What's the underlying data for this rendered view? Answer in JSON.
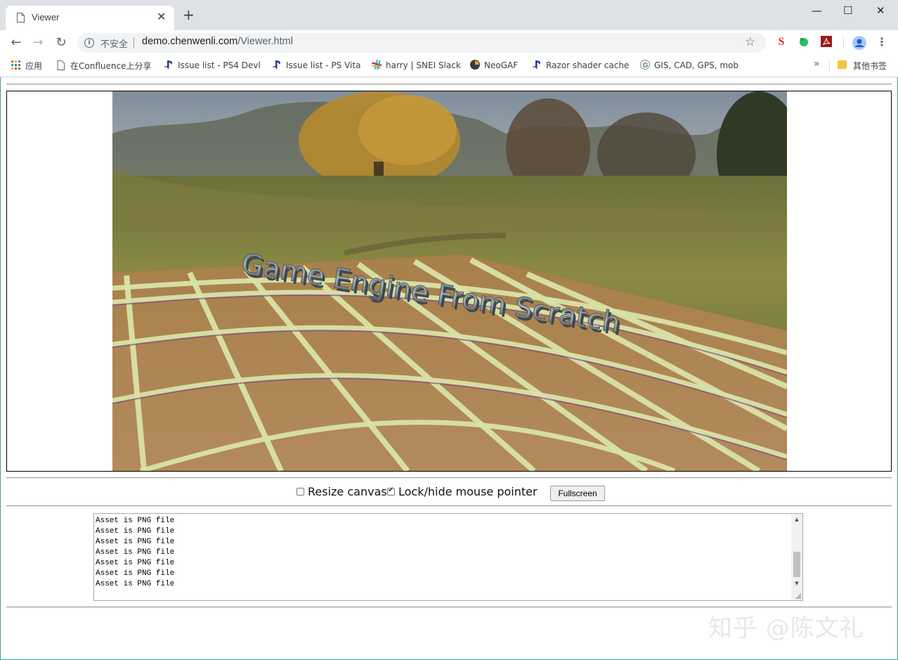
{
  "browser": {
    "tab": {
      "title": "Viewer",
      "close": "✕"
    },
    "new_tab": "+",
    "window_controls": {
      "minimize": "—",
      "maximize": "☐",
      "close": "✕"
    },
    "toolbar": {
      "back": "←",
      "forward": "→",
      "reload": "↻"
    },
    "address": {
      "security_label": "不安全",
      "host": "demo.chenwenli.com",
      "path": "/Viewer.html"
    },
    "extensions": [
      "s-extension-icon",
      "evernote-icon",
      "pdf-icon",
      "profile-avatar-icon",
      "menu-icon"
    ],
    "bookmarks": [
      {
        "label": "应用",
        "icon": "apps-grid-icon"
      },
      {
        "label": "在Confluence上分享",
        "icon": "page-icon"
      },
      {
        "label": "Issue list - PS4 Devl",
        "icon": "playstation-icon"
      },
      {
        "label": "Issue list - PS Vita",
        "icon": "playstation-icon"
      },
      {
        "label": "harry | SNEI Slack",
        "icon": "slack-icon"
      },
      {
        "label": "NeoGAF",
        "icon": "neogaf-icon"
      },
      {
        "label": "Razor shader cache",
        "icon": "playstation-icon"
      },
      {
        "label": "GIS, CAD, GPS, mob",
        "icon": "g-icon"
      }
    ],
    "bookmarks_more": "»",
    "other_bookmarks": "其他书签"
  },
  "viewer": {
    "scene_text": "Game Engine From Scratch",
    "resize_canvas": {
      "label": "Resize canvas",
      "checked": false
    },
    "lock_mouse": {
      "label": "Lock/hide mouse pointer",
      "checked": true
    },
    "fullscreen_button": "Fullscreen",
    "output_lines": [
      "Asset is PNG file",
      "Asset is PNG file",
      "Asset is PNG file",
      "Asset is PNG file",
      "Asset is PNG file",
      "Asset is PNG file",
      "Asset is PNG file"
    ]
  },
  "watermark": "知乎 @陈文礼",
  "colors": {
    "tabstrip": "#dee1e6",
    "omnibox": "#f1f3f4",
    "frame_border": "#37a3a3"
  }
}
